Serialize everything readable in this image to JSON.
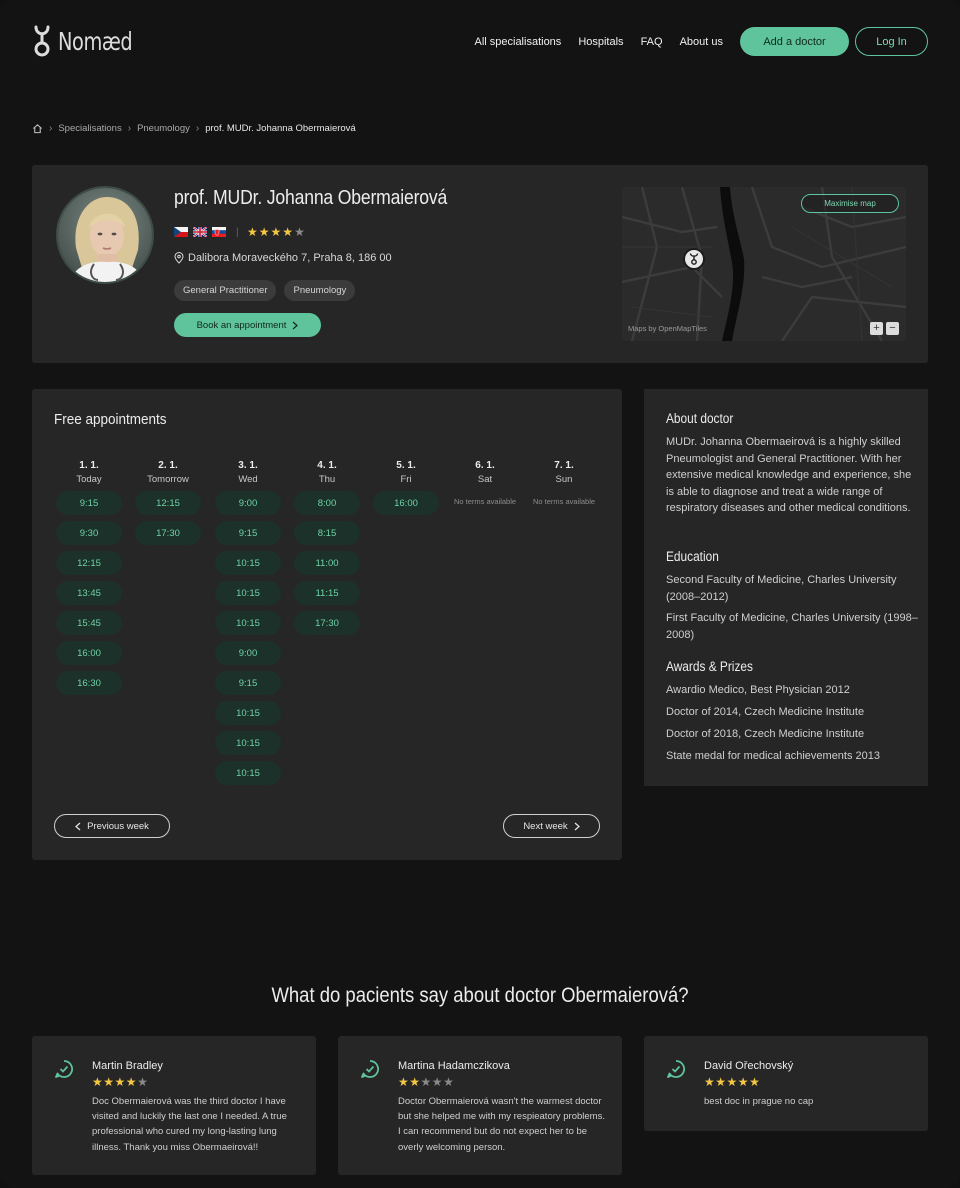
{
  "header": {
    "logo_text": "Nomæd",
    "nav": [
      "All specialisations",
      "Hospitals",
      "FAQ",
      "About us"
    ],
    "add_doctor_label": "Add a doctor",
    "login_label": "Log In"
  },
  "breadcrumb": {
    "items": [
      "Specialisations",
      "Pneumology"
    ],
    "current": "prof. MUDr. Johanna Obermaierová"
  },
  "doctor": {
    "name": "prof. MUDr. Johanna Obermaierová",
    "languages": [
      "cz-flag-icon",
      "uk-flag-icon",
      "sk-flag-icon"
    ],
    "rating": 4,
    "rating_max": 5,
    "address": "Dalibora Moraveckého 7, Praha 8, 186 00",
    "tags": [
      "General Practitioner",
      "Pneumology"
    ],
    "book_label": "Book an appointment"
  },
  "map": {
    "maximise_label": "Maximise map",
    "attribution": "Maps by OpenMapTiles",
    "zoom_in": "+",
    "zoom_out": "−"
  },
  "appointments": {
    "title": "Free appointments",
    "days": [
      {
        "date": "1. 1.",
        "name": "Today",
        "slots": [
          "9:15",
          "9:30",
          "12:15",
          "13:45",
          "15:45",
          "16:00",
          "16:30"
        ]
      },
      {
        "date": "2. 1.",
        "name": "Tomorrow",
        "slots": [
          "12:15",
          "17:30"
        ]
      },
      {
        "date": "3. 1.",
        "name": "Wed",
        "slots": [
          "9:00",
          "9:15",
          "10:15",
          "10:15",
          "10:15",
          "9:00",
          "9:15",
          "10:15",
          "10:15",
          "10:15"
        ]
      },
      {
        "date": "4. 1.",
        "name": "Thu",
        "slots": [
          "8:00",
          "8:15",
          "11:00",
          "11:15",
          "17:30"
        ]
      },
      {
        "date": "5. 1.",
        "name": "Fri",
        "slots": [
          "16:00"
        ]
      },
      {
        "date": "6. 1.",
        "name": "Sat",
        "slots": [],
        "empty_label": "No terms available"
      },
      {
        "date": "7. 1.",
        "name": "Sun",
        "slots": [],
        "empty_label": "No terms available"
      }
    ],
    "prev_label": "Previous week",
    "next_label": "Next week"
  },
  "about": {
    "heading": "About doctor",
    "text": "MUDr. Johanna Obermaeirová is a highly skilled Pneumologist and General Practitioner. With her extensive medical knowledge and experience, she is able to diagnose and treat a wide range of respiratory diseases and other medical conditions.",
    "education_heading": "Education",
    "education": [
      "Second Faculty of Medicine, Charles University (2008–2012)",
      "First Faculty of Medicine, Charles University (1998–2008)"
    ],
    "awards_heading": "Awards & Prizes",
    "awards": [
      "Awardio Medico, Best Physician 2012",
      "Doctor of 2014, Czech Medicine Institute",
      "Doctor of 2018, Czech Medicine Institute",
      "State medal for medical achievements 2013"
    ]
  },
  "reviews": {
    "title": "What do pacients say about doctor Obermaierová?",
    "items": [
      {
        "author": "Martin Bradley",
        "rating": 4,
        "text": "Doc Obermaierová was the third doctor I have visited and luckily the last one I needed. A true professional who cured my long-lasting lung illness. Thank you miss Obermaeirová!!"
      },
      {
        "author": "Martina Hadamczikova",
        "rating": 2,
        "text": "Doctor Obermaierová wasn't the warmest doctor but she helped me with my respieatory problems. I can recommend but do not expect her to be overly welcoming person."
      },
      {
        "author": "David Ořechovský",
        "rating": 5,
        "text": "best doc in prague no cap"
      }
    ]
  },
  "colors": {
    "accent": "#5fc39b",
    "background": "#131313",
    "card": "#262626",
    "star": "#f3c744"
  }
}
